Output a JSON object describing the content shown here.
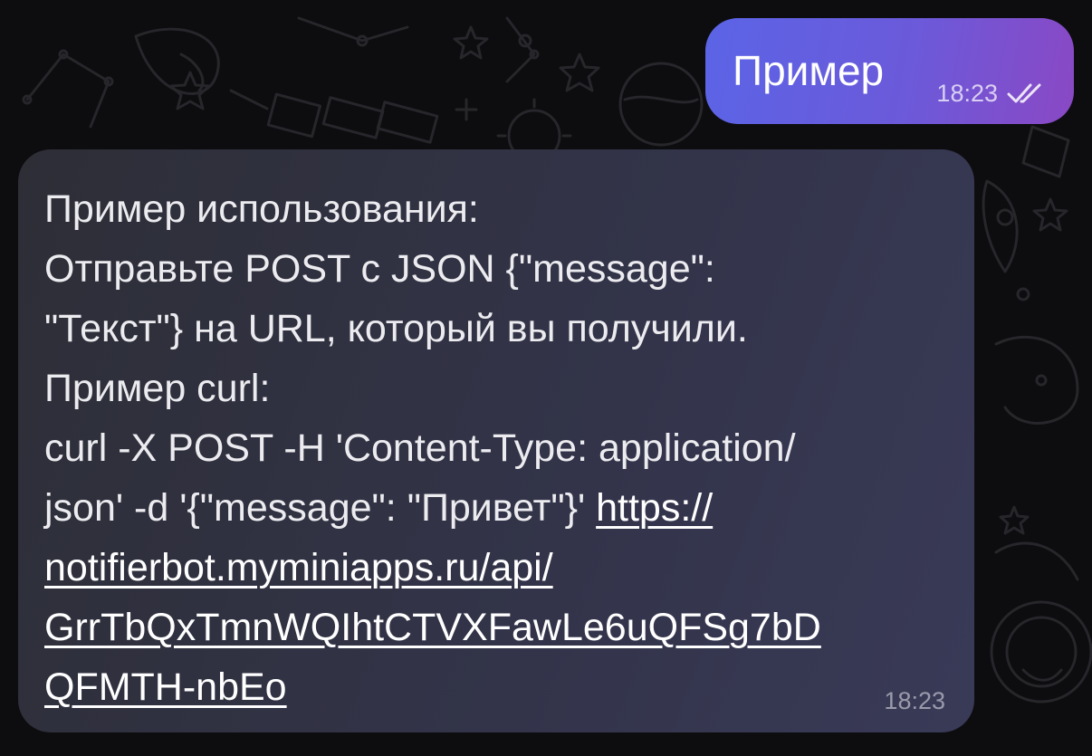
{
  "chat": {
    "outgoing": {
      "text": "Пример",
      "time": "18:23",
      "status_icon": "double-check-icon"
    },
    "incoming": {
      "lines": [
        "Пример использования:",
        "Отправьте POST с JSON {\"message\":",
        "\"Текст\"} на URL, который вы получили.",
        "Пример curl:",
        "curl -X POST -H 'Content-Type: application/",
        "json' -d '{\"message\": \"Привет\"}' "
      ],
      "link_lines": [
        "https://",
        "notifierbot.myminiapps.ru/api/",
        "GrrTbQxTmnWQIhtCTVXFawLe6uQFSg7bD",
        "QFMTH-nbEo"
      ],
      "time": "18:23"
    }
  },
  "colors": {
    "background": "#0d0d0f",
    "outgoing_bubble_start": "#5b64e6",
    "outgoing_bubble_end": "#8a48c4",
    "incoming_bubble": "#2d2e36",
    "text": "#ececf0"
  }
}
